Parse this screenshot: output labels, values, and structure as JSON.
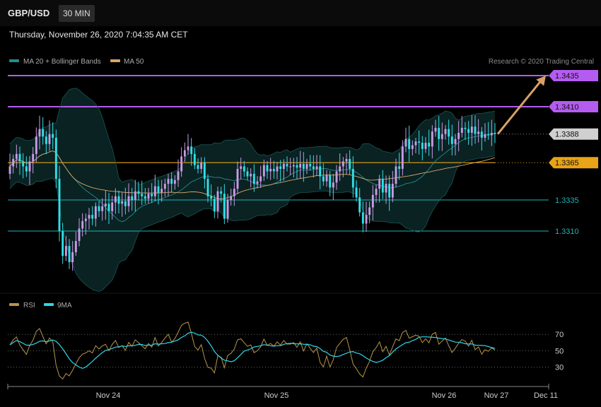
{
  "header": {
    "symbol": "GBP/USD",
    "interval": "30 MIN",
    "timestamp": "Thursday, November 26, 2020 7:04:35 AM CET"
  },
  "legend": {
    "ma20": {
      "label": "MA 20 + Bollinger Bands",
      "color": "#1f8f8f"
    },
    "ma50": {
      "label": "MA 50",
      "color": "#d9a66a"
    },
    "credit": "Research © 2020 Trading Central"
  },
  "rsi_legend": {
    "rsi": {
      "label": "RSI",
      "color": "#b8944a"
    },
    "ma9": {
      "label": "9MA",
      "color": "#2fd6e8"
    }
  },
  "colors": {
    "up": "#c89be6",
    "down": "#2fe0e8",
    "resistance": "#b45cf0",
    "pivot": "#e8a317",
    "support": "#1fb5b5",
    "last": "#d0d0d0",
    "arrow": "#d9a066"
  },
  "chart_data": [
    {
      "type": "candlestick",
      "title": "GBP/USD",
      "interval": "30 MIN",
      "ylim": [
        1.3255,
        1.346
      ],
      "x_tick_labels": [
        "Nov 24",
        "Nov 25",
        "Nov 26",
        "Nov 27",
        "Dec 11"
      ],
      "price_levels": [
        {
          "value": 1.3435,
          "label": "1.3435",
          "kind": "resistance"
        },
        {
          "value": 1.341,
          "label": "1.3410",
          "kind": "resistance"
        },
        {
          "value": 1.3388,
          "label": "1.3388",
          "kind": "last"
        },
        {
          "value": 1.3365,
          "label": "1.3365",
          "kind": "pivot"
        },
        {
          "value": 1.3335,
          "label": "1.3335",
          "kind": "support"
        },
        {
          "value": 1.331,
          "label": "1.3310",
          "kind": "support"
        }
      ],
      "target_arrow": {
        "from": 1.3388,
        "to": 1.3435
      },
      "series": [
        {
          "name": "MA 20 + Bollinger Bands",
          "kind": "bollinger"
        },
        {
          "name": "MA 50",
          "kind": "ma"
        }
      ],
      "close": [
        1.3362,
        1.3368,
        1.3372,
        1.3366,
        1.3362,
        1.3358,
        1.3366,
        1.3372,
        1.3386,
        1.3392,
        1.3386,
        1.338,
        1.3388,
        1.3385,
        1.3352,
        1.331,
        1.329,
        1.3298,
        1.3285,
        1.3293,
        1.3302,
        1.3312,
        1.3318,
        1.332,
        1.3323,
        1.332,
        1.333,
        1.3326,
        1.333,
        1.3332,
        1.3326,
        1.3333,
        1.3338,
        1.3332,
        1.3334,
        1.333,
        1.3338,
        1.3335,
        1.3342,
        1.334,
        1.3338,
        1.3336,
        1.334,
        1.3338,
        1.3346,
        1.3341,
        1.3344,
        1.3348,
        1.3352,
        1.3348,
        1.3351,
        1.3358,
        1.337,
        1.3375,
        1.3378,
        1.3372,
        1.3363,
        1.336,
        1.3365,
        1.3352,
        1.3338,
        1.3336,
        1.3326,
        1.3342,
        1.334,
        1.332,
        1.3335,
        1.3338,
        1.3344,
        1.336,
        1.3362,
        1.3358,
        1.3354,
        1.3356,
        1.3348,
        1.335,
        1.3354,
        1.3363,
        1.3358,
        1.336,
        1.3358,
        1.3362,
        1.336,
        1.3364,
        1.3362,
        1.3362,
        1.3363,
        1.3361,
        1.3364,
        1.336,
        1.3364,
        1.3362,
        1.336,
        1.3362,
        1.3354,
        1.335,
        1.3355,
        1.3345,
        1.3349,
        1.3358,
        1.3362,
        1.3366,
        1.3368,
        1.336,
        1.3345,
        1.3337,
        1.3325,
        1.3316,
        1.3323,
        1.3329,
        1.3339,
        1.3344,
        1.3352,
        1.3341,
        1.3348,
        1.3337,
        1.3348,
        1.3362,
        1.336,
        1.3378,
        1.3384,
        1.3376,
        1.3379,
        1.3382,
        1.3381,
        1.3376,
        1.3381,
        1.3378,
        1.339,
        1.3393,
        1.3384,
        1.3388,
        1.3392,
        1.3386,
        1.338,
        1.3384,
        1.3389,
        1.3393,
        1.3392,
        1.3389,
        1.3394,
        1.3388,
        1.339,
        1.3385,
        1.3388,
        1.3387,
        1.3389,
        1.3388
      ],
      "rsi": {
        "ylim": [
          15,
          90
        ],
        "levels": [
          70,
          50,
          30
        ],
        "level_labels": [
          "70",
          "50",
          "30"
        ]
      }
    }
  ]
}
